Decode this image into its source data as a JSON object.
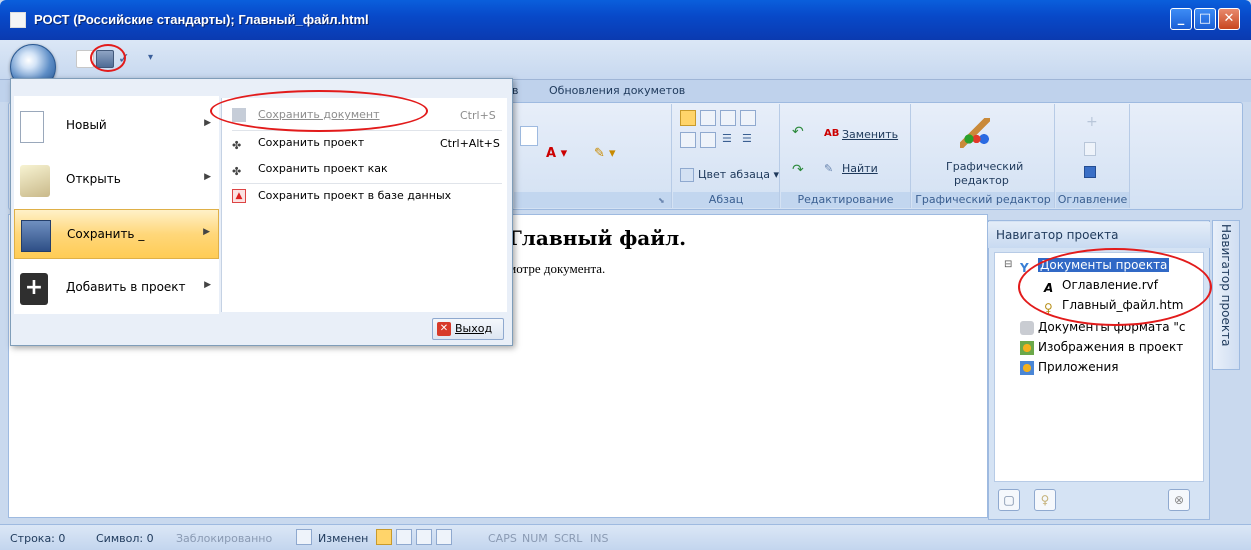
{
  "window": {
    "title": "РОСТ (Российские стандарты);  Главный_файл.html",
    "min_label": "_",
    "max_label": "□",
    "close_label": "✕"
  },
  "quick_access": {
    "more_label": "▾"
  },
  "ribbon": {
    "tabs": [
      "в",
      "Обновления докуметов"
    ],
    "groups": {
      "paragraph": {
        "label": "Абзац",
        "color_label": "Цвет абзаца"
      },
      "editing": {
        "label": "Редактирование",
        "replace_label": "Заменить",
        "find_label": "Найти"
      },
      "graphic": {
        "label": "Графический редактор",
        "button_label_1": "Графический",
        "button_label_2": "редактор"
      },
      "toc": {
        "label": "Оглавление"
      }
    }
  },
  "app_menu": {
    "items": [
      {
        "label": "Новый",
        "icon": "new-document-icon"
      },
      {
        "label": "Открыть",
        "icon": "open-folder-icon"
      },
      {
        "label": "Сохранить _",
        "icon": "save-disk-icon"
      },
      {
        "label": "Добавить в проект",
        "icon": "add-plus-icon"
      }
    ],
    "submenu": [
      {
        "label": "Сохранить документ",
        "shortcut": "Ctrl+S",
        "disabled": true
      },
      {
        "label": "Сохранить проект",
        "shortcut": "Ctrl+Alt+S",
        "disabled": false
      },
      {
        "label": "Сохранить проект как",
        "shortcut": "",
        "disabled": false
      },
      {
        "label": "Сохранить проект в базе данных",
        "shortcut": "",
        "disabled": false
      }
    ],
    "exit_label": "Выход"
  },
  "document": {
    "heading": "Главный файл.",
    "text": "мотре документа."
  },
  "navigator": {
    "title": "Навигатор проекта",
    "side_tab": "Навигатор проекта",
    "tree": [
      {
        "label": "Документы проекта",
        "selected": true
      },
      {
        "label": "Оглавление.rvf",
        "selected": false
      },
      {
        "label": "Главный_файл.htm",
        "selected": false
      },
      {
        "label": "Документы формата \"с",
        "selected": false
      },
      {
        "label": "Изображения в проект",
        "selected": false
      },
      {
        "label": "Приложения",
        "selected": false
      }
    ]
  },
  "statusbar": {
    "line": "Строка: 0",
    "symbol": "Символ: 0",
    "locked": "Заблокированно",
    "changed": "Изменен",
    "caps": "CAPS",
    "num": "NUM",
    "scrl": "SCRL",
    "ins": "INS"
  },
  "colors": {
    "titlebar": "#0849c9",
    "selection": "#3169c6",
    "menu_active": "#ffd77a",
    "annotation": "#e21b1b"
  }
}
